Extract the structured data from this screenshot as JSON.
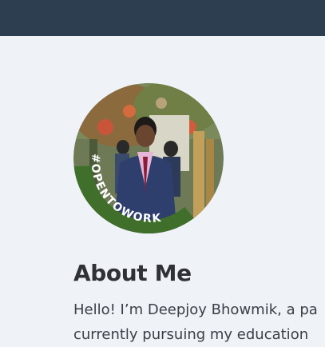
{
  "profile": {
    "badge_text": "#OPENTOWORK",
    "badge_color": "#3f6f2a",
    "avatar_icon": "profile-photo"
  },
  "about": {
    "title": "About Me",
    "line1": "Hello! I’m Deepjoy Bhowmik, a pa",
    "line2": "currently pursuing my education"
  },
  "colors": {
    "navbar": "#2c3e50",
    "page_bg": "#eff3f8"
  }
}
